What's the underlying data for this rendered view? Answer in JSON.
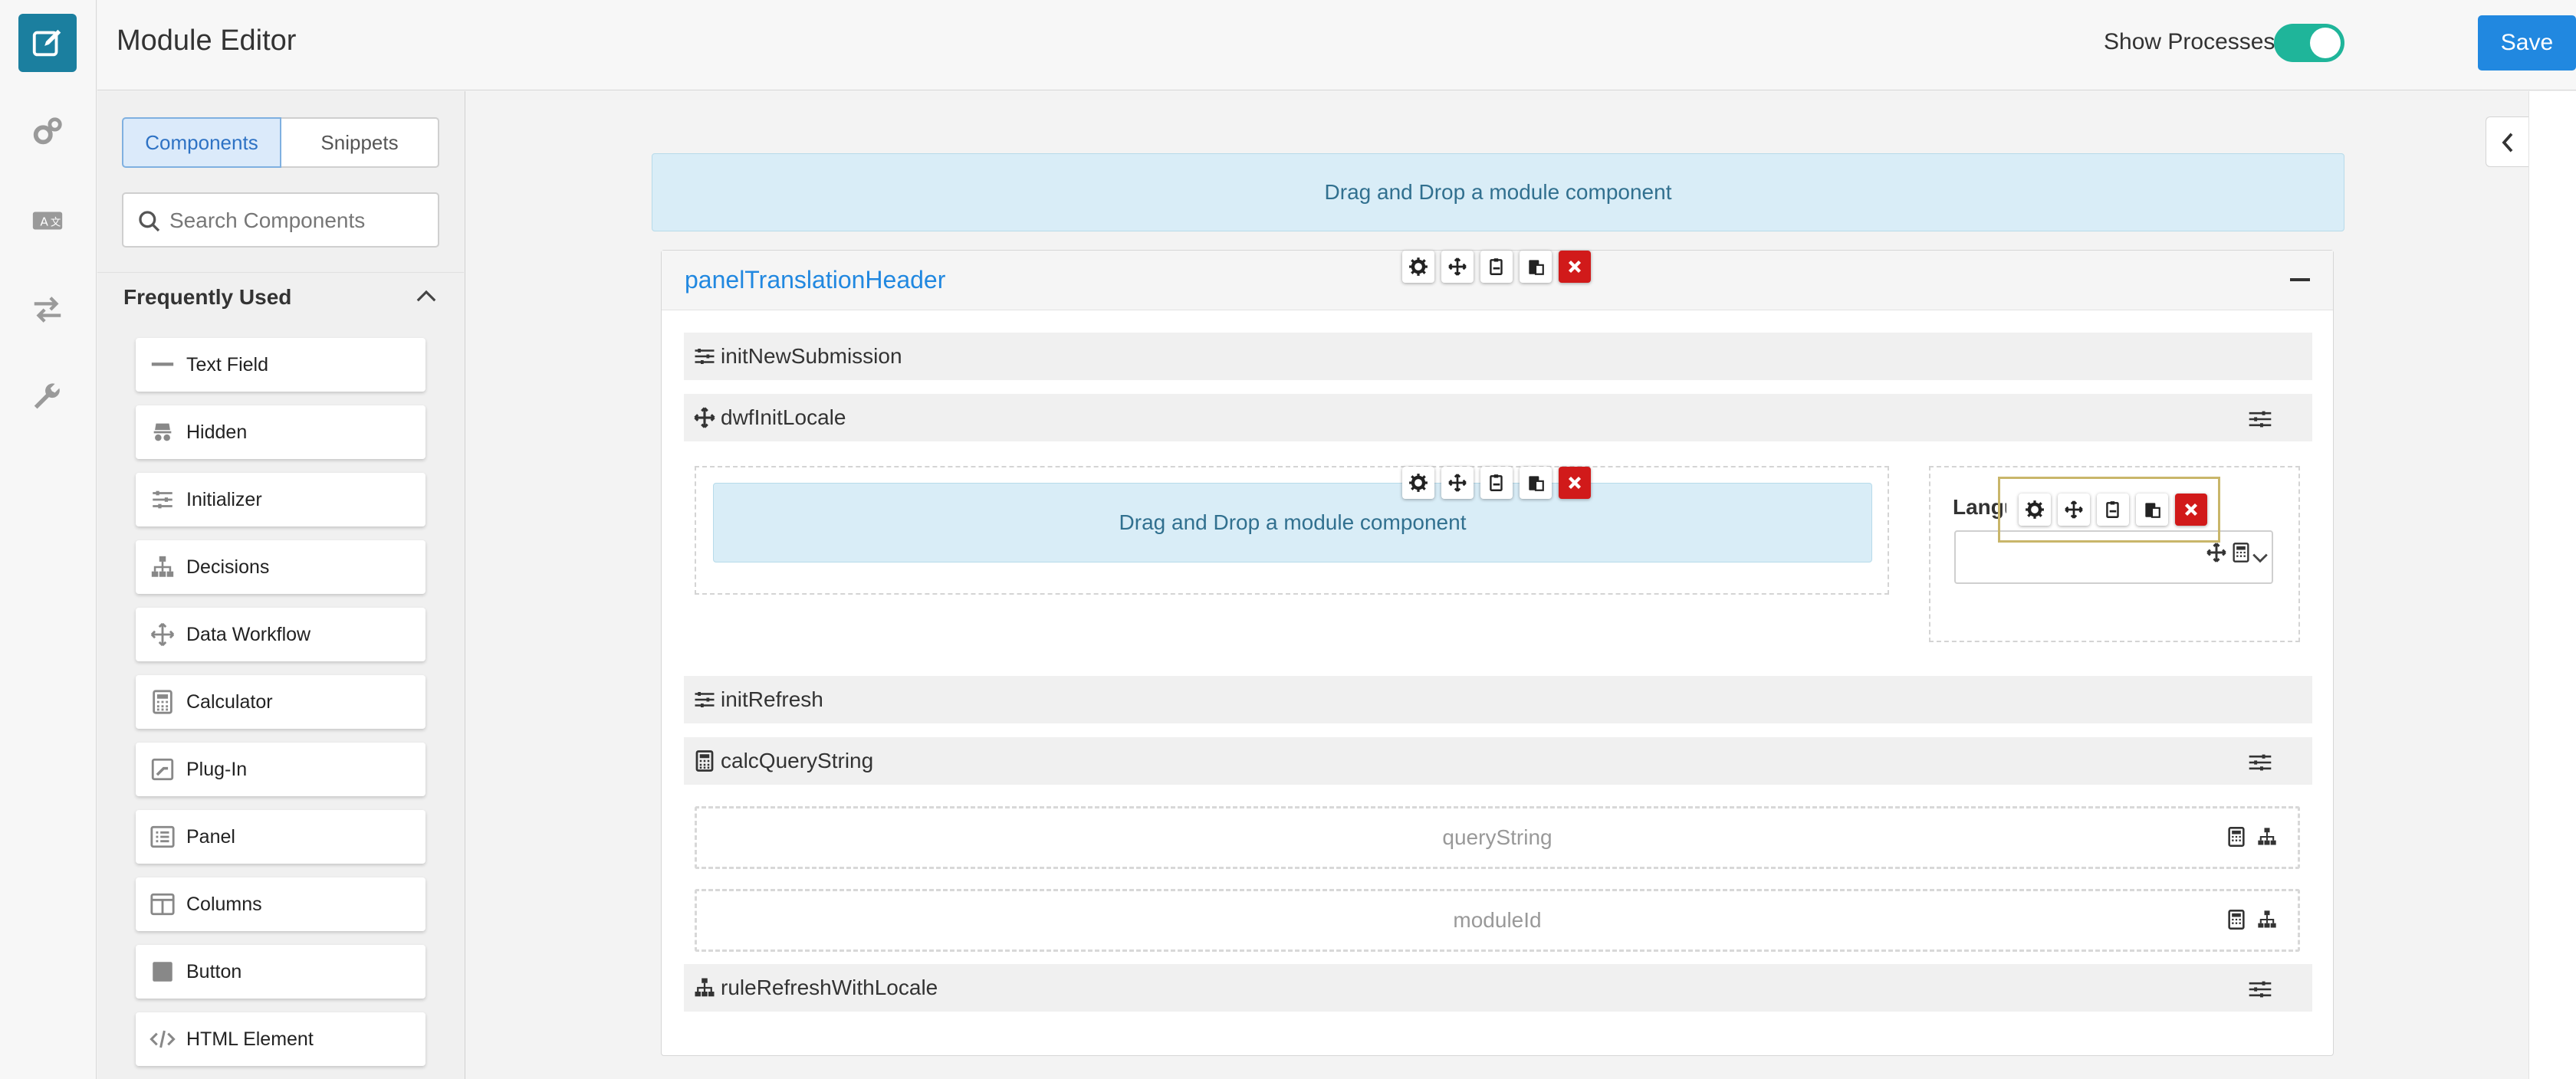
{
  "header": {
    "title": "Module Editor",
    "show_processes_label": "Show Processes",
    "show_processes_on": true,
    "save_label": "Save",
    "more_label": "•••"
  },
  "rail": {
    "items": [
      "edit-icon",
      "gears-icon",
      "translate-icon",
      "transfer-arrows-icon",
      "wrench-icon"
    ],
    "active": "edit-icon"
  },
  "sidebar": {
    "tabs": [
      "Components",
      "Snippets"
    ],
    "active_tab": "Components",
    "search_placeholder": "Search Components",
    "section_title": "Frequently Used",
    "components": [
      {
        "label": "Text Field",
        "icon": "text-field-icon"
      },
      {
        "label": "Hidden",
        "icon": "hidden-icon"
      },
      {
        "label": "Initializer",
        "icon": "sliders-icon"
      },
      {
        "label": "Decisions",
        "icon": "sitemap-icon"
      },
      {
        "label": "Data Workflow",
        "icon": "move-arrows-icon"
      },
      {
        "label": "Calculator",
        "icon": "calculator-icon"
      },
      {
        "label": "Plug-In",
        "icon": "plugin-icon"
      },
      {
        "label": "Panel",
        "icon": "list-icon"
      },
      {
        "label": "Columns",
        "icon": "columns-icon"
      },
      {
        "label": "Button",
        "icon": "square-icon"
      },
      {
        "label": "HTML Element",
        "icon": "code-icon"
      }
    ]
  },
  "canvas": {
    "dropzone_text": "Drag and Drop a module component",
    "panel_title": "panelTranslationHeader",
    "rows": {
      "init_new_submission": "initNewSubmission",
      "dwf_init_locale": "dwfInitLocale",
      "init_refresh": "initRefresh",
      "calc_query_string": "calcQueryString",
      "rule_refresh": "ruleRefreshWithLocale"
    },
    "language_label": "Language",
    "fields": [
      "queryString",
      "moduleId"
    ]
  },
  "colors": {
    "accent": "#2188e0",
    "teal": "#1b7f9f",
    "toggle_on": "#1fb59a",
    "delete": "#d11a1a",
    "dropzone_bg": "#d9edf7"
  }
}
